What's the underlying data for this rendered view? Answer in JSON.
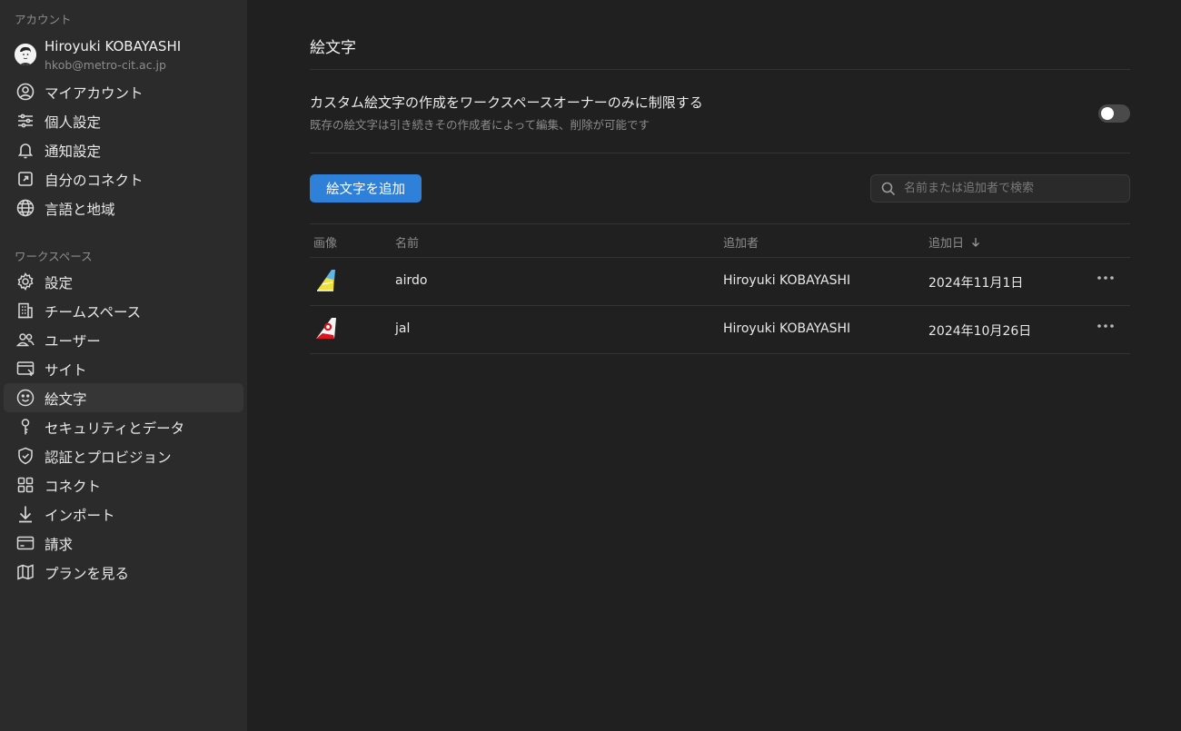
{
  "sidebar": {
    "account_section_label": "アカウント",
    "user": {
      "name": "Hiroyuki KOBAYASHI",
      "email": "hkob@metro-cit.ac.jp"
    },
    "account_items": [
      {
        "label": "マイアカウント",
        "icon": "user-circle-icon"
      },
      {
        "label": "個人設定",
        "icon": "sliders-icon"
      },
      {
        "label": "通知設定",
        "icon": "bell-icon"
      },
      {
        "label": "自分のコネクト",
        "icon": "external-link-icon"
      },
      {
        "label": "言語と地域",
        "icon": "globe-icon"
      }
    ],
    "workspace_section_label": "ワークスペース",
    "workspace_items": [
      {
        "label": "設定",
        "icon": "gear-icon"
      },
      {
        "label": "チームスペース",
        "icon": "building-icon"
      },
      {
        "label": "ユーザー",
        "icon": "users-icon"
      },
      {
        "label": "サイト",
        "icon": "browser-icon"
      },
      {
        "label": "絵文字",
        "icon": "smiley-icon",
        "active": true
      },
      {
        "label": "セキュリティとデータ",
        "icon": "key-icon"
      },
      {
        "label": "認証とプロビジョン",
        "icon": "shield-check-icon"
      },
      {
        "label": "コネクト",
        "icon": "grid-icon"
      },
      {
        "label": "インポート",
        "icon": "arrow-down-icon"
      },
      {
        "label": "請求",
        "icon": "credit-card-icon"
      },
      {
        "label": "プランを見る",
        "icon": "map-icon"
      }
    ]
  },
  "main": {
    "title": "絵文字",
    "restrict_setting": {
      "title": "カスタム絵文字の作成をワークスペースオーナーのみに制限する",
      "description": "既存の絵文字は引き続きその作成者によって編集、削除が可能です",
      "enabled": false
    },
    "add_button_label": "絵文字を追加",
    "search_placeholder": "名前または追加者で検索",
    "table": {
      "headers": {
        "image": "画像",
        "name": "名前",
        "added_by": "追加者",
        "added_on": "追加日"
      },
      "sort_icon": "arrow-down-icon",
      "rows": [
        {
          "name": "airdo",
          "added_by": "Hiroyuki KOBAYASHI",
          "added_on": "2024年11月1日",
          "image_icon": "airdo-tail-icon"
        },
        {
          "name": "jal",
          "added_by": "Hiroyuki KOBAYASHI",
          "added_on": "2024年10月26日",
          "image_icon": "jal-tail-icon"
        }
      ]
    }
  },
  "colors": {
    "accent": "#2f80d8",
    "sidebar_bg": "#2b2b2b",
    "main_bg": "#202020"
  }
}
